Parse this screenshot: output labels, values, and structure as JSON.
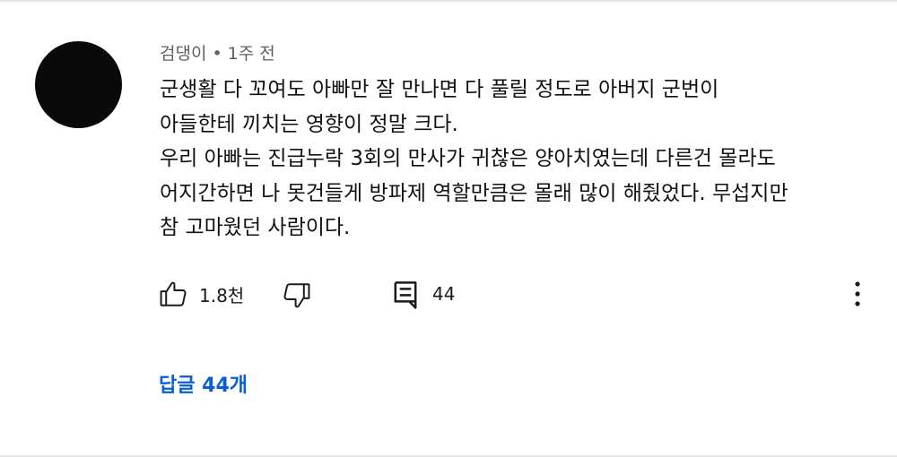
{
  "comment": {
    "author": "검댕이",
    "separator": "•",
    "time": "1주 전",
    "text_lines": [
      "군생활 다 꼬여도 아빠만 잘 만나면 다 풀릴 정도로 아버지 군번이",
      "아들한테 끼치는 영향이 정말 크다.",
      "우리 아빠는 진급누락 3회의 만사가 귀찮은 양아치였는데 다른건 몰라도",
      "어지간하면 나 못건들게 방파제 역할만큼은 몰래 많이 해줬었다. 무섭지만",
      "참 고마웠던 사람이다."
    ],
    "avatar_color": "#0a0a0a"
  },
  "actions": {
    "like_icon": "thumbs-up-icon",
    "like_count": "1.8천",
    "dislike_icon": "thumbs-down-icon",
    "reply_icon": "comment-icon",
    "reply_count": "44",
    "more_icon": "more-vertical-icon"
  },
  "replies": {
    "label": "답글 44개",
    "color": "#065fd4"
  }
}
